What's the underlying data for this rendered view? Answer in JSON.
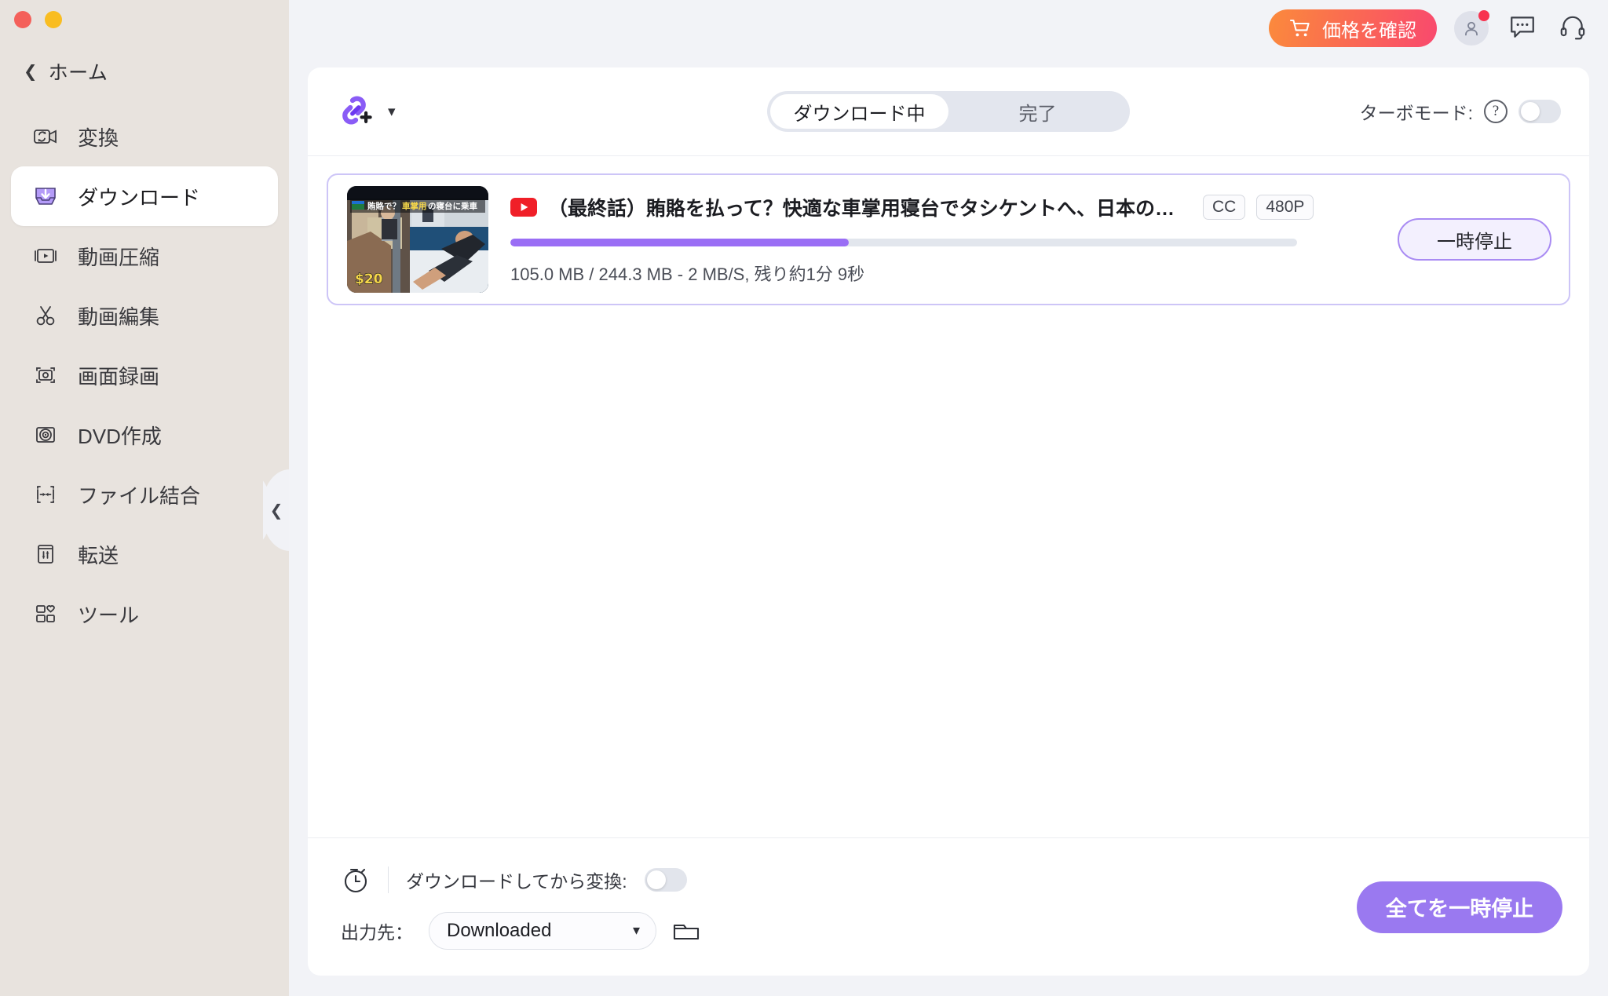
{
  "window": {
    "traffic_lights": [
      "close",
      "minimize"
    ],
    "colors": {
      "close": "#f4605a",
      "minimize": "#f9bd21"
    }
  },
  "sidebar": {
    "back_label": "ホーム",
    "items": [
      {
        "label": "変換",
        "icon": "convert-video-icon",
        "active": false
      },
      {
        "label": "ダウンロード",
        "icon": "download-tray-icon",
        "active": true
      },
      {
        "label": "動画圧縮",
        "icon": "video-compress-icon",
        "active": false
      },
      {
        "label": "動画編集",
        "icon": "scissors-icon",
        "active": false
      },
      {
        "label": "画面録画",
        "icon": "screen-record-icon",
        "active": false
      },
      {
        "label": "DVD作成",
        "icon": "disc-icon",
        "active": false
      },
      {
        "label": "ファイル結合",
        "icon": "merge-files-icon",
        "active": false
      },
      {
        "label": "転送",
        "icon": "transfer-icon",
        "active": false
      },
      {
        "label": "ツール",
        "icon": "toolbox-grid-icon",
        "active": false
      }
    ],
    "collapse_handle_icon": "chevron-left-icon"
  },
  "topbar": {
    "price_button_label": "価格を確認",
    "price_button_icon": "shopping-cart-icon",
    "price_button_gradient": [
      "#fb8a3c",
      "#f9496e"
    ],
    "account_icon": "user-avatar-icon",
    "account_has_notification": true,
    "notification_color": "#f8334f",
    "feedback_icon": "chat-bubble-icon",
    "support_icon": "headset-icon"
  },
  "panel": {
    "add_link_icon": "link-plus-icon",
    "add_link_dropdown_icon": "chevron-down-icon",
    "tabs": [
      {
        "label": "ダウンロード中",
        "active": true
      },
      {
        "label": "完了",
        "active": false
      }
    ],
    "turbo": {
      "label": "ターボモード:",
      "help_icon": "question-mark-circle-icon",
      "help_glyph": "?",
      "enabled": false
    }
  },
  "downloads": [
    {
      "thumbnail": {
        "overlay_title": "賄賂で？車掌用の寝台に乗車",
        "overlay_price": "$20"
      },
      "source_icon": "youtube-icon",
      "title": "（最終話）賄賂を払って？快適な車掌用寝台でタシケントへ、日本の先人…",
      "tags": [
        "CC",
        "480P"
      ],
      "progress_percent": 43,
      "progress_color": "#9a6ef5",
      "status": "105.0 MB / 244.3 MB - 2 MB/S, 残り約1分 9秒",
      "downloaded_size": "105.0 MB",
      "total_size": "244.3 MB",
      "speed": "2 MB/S",
      "time_remaining": "残り約1分 9秒",
      "action_label": "一時停止"
    }
  ],
  "footer": {
    "timer_icon": "stopwatch-icon",
    "convert_after_download_label": "ダウンロードしてから変換:",
    "convert_after_download_enabled": false,
    "output_label": "出力先：",
    "output_value": "Downloaded",
    "output_caret_icon": "chevron-down-icon",
    "open_folder_icon": "folder-icon",
    "pause_all_label": "全てを一時停止",
    "pause_all_color": "#9a79f0"
  }
}
